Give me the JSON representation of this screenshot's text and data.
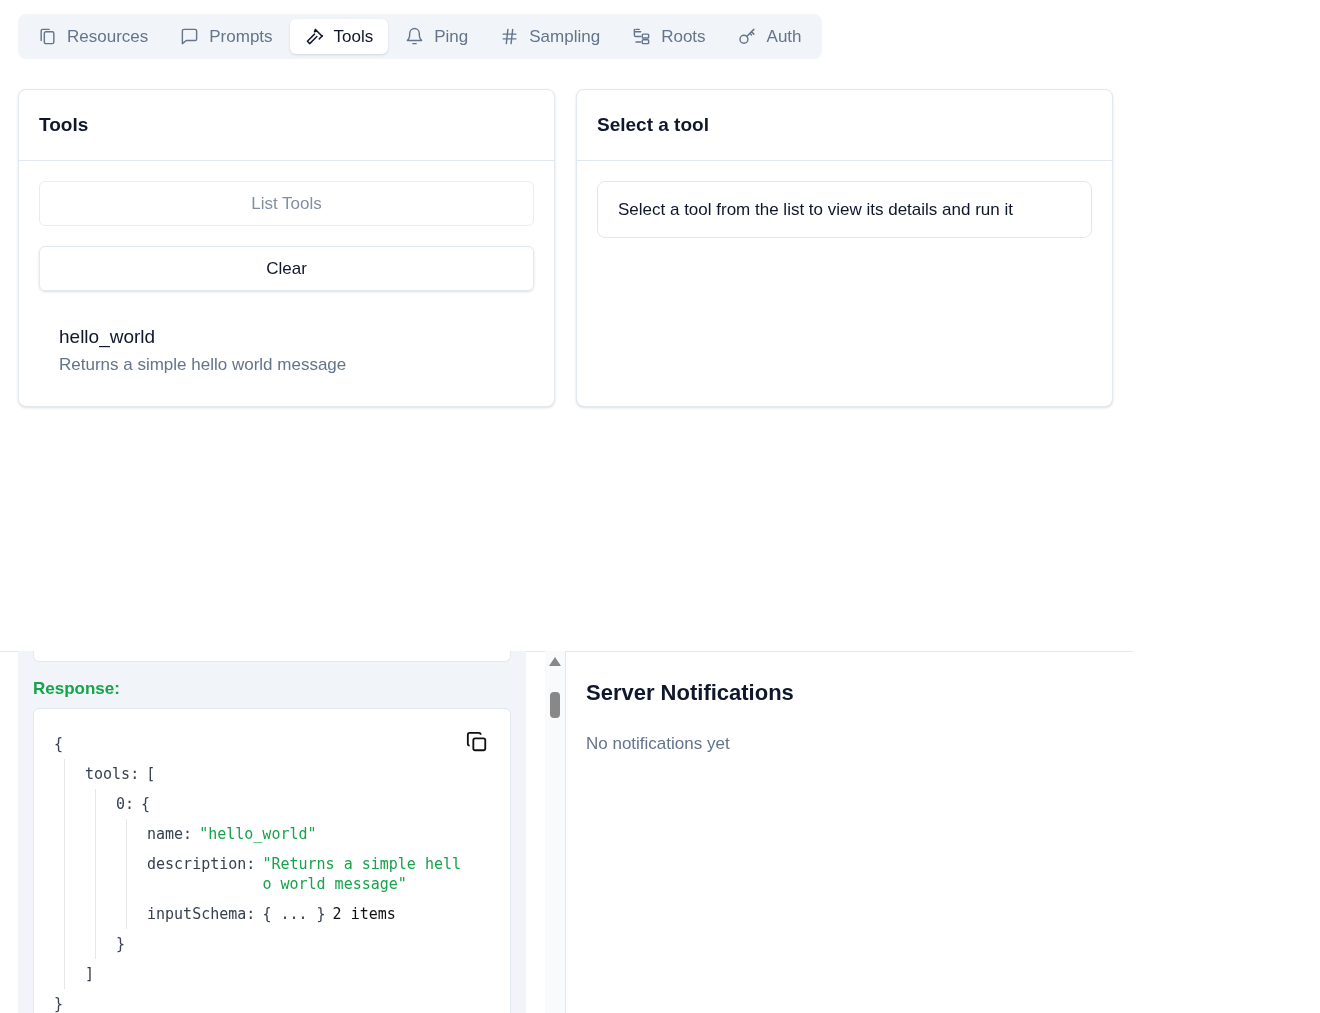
{
  "tabs": [
    {
      "label": "Resources",
      "kind": "files",
      "selected": false
    },
    {
      "label": "Prompts",
      "kind": "chat",
      "selected": false
    },
    {
      "label": "Tools",
      "kind": "hammer",
      "selected": true
    },
    {
      "label": "Ping",
      "kind": "bell",
      "selected": false
    },
    {
      "label": "Sampling",
      "kind": "hash",
      "selected": false
    },
    {
      "label": "Roots",
      "kind": "tree",
      "selected": false
    },
    {
      "label": "Auth",
      "kind": "key",
      "selected": false
    }
  ],
  "tools_panel": {
    "title": "Tools",
    "buttons": [
      {
        "label": "List Tools",
        "disabled": true
      },
      {
        "label": "Clear",
        "disabled": false
      }
    ],
    "items": [
      {
        "name": "hello_world",
        "description": "Returns a simple hello world message"
      }
    ]
  },
  "detail_panel": {
    "title": "Select a tool",
    "message": "Select a tool from the list to view its details and run it"
  },
  "response": {
    "label": "Response:",
    "open": "{",
    "close": "}",
    "children": [
      {
        "key": "tools:",
        "open": "[",
        "close": "]",
        "children": [
          {
            "key": "0:",
            "open": "{",
            "close": "}",
            "children": [
              {
                "key": "name:",
                "value": "\"hello_world\""
              },
              {
                "key": "description:",
                "value": "\"Returns a simple hello world message\""
              },
              {
                "key": "inputSchema:",
                "preview": "{ ... }",
                "count": "2 items"
              }
            ]
          }
        ]
      }
    ]
  },
  "notifications": {
    "title": "Server Notifications",
    "message": "No notifications yet"
  }
}
